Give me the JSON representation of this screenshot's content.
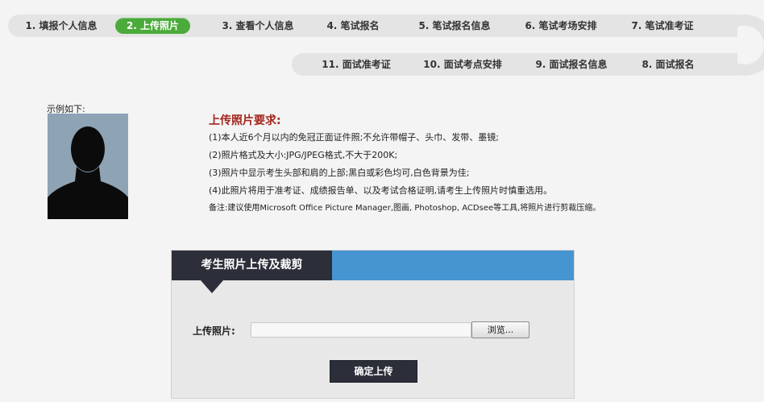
{
  "steps": {
    "s1": "1. 填报个人信息",
    "s2": "2. 上传照片",
    "s3": "3. 查看个人信息",
    "s4": "4. 笔试报名",
    "s5": "5. 笔试报名信息",
    "s6": "6. 笔试考场安排",
    "s7": "7. 笔试准考证",
    "s8": "8. 面试报名",
    "s9": "9. 面试报名信息",
    "s10": "10. 面试考点安排",
    "s11": "11. 面试准考证",
    "active_step": "2. 上传照片",
    "active_color": "#4aaa3a"
  },
  "example": {
    "label": "示例如下:",
    "icon": "person-silhouette-icon"
  },
  "requirements": {
    "title": "上传照片要求:",
    "items": [
      "(1)本人近6个月以内的免冠正面证件照;不允许带帽子、头巾、发带、墨镜;",
      "(2)照片格式及大小:JPG/JPEG格式,不大于200K;",
      "(3)照片中显示考生头部和肩的上部;黑白或彩色均可,白色背景为佳;",
      "(4)此照片将用于准考证、成绩报告单、以及考试合格证明,请考生上传照片时慎重选用。"
    ],
    "note": "备注:建议使用Microsoft Office Picture Manager,图画, Photoshop, ACDsee等工具,将照片进行剪裁压缩。",
    "title_color": "#a3261c"
  },
  "upload_panel": {
    "header": "考生照片上传及裁剪",
    "field_label": "上传照片:",
    "file_value": "",
    "browse_label": "浏览...",
    "confirm_label": "确定上传",
    "header_color": "#2c2f3a",
    "accent_color": "#4695d1"
  }
}
